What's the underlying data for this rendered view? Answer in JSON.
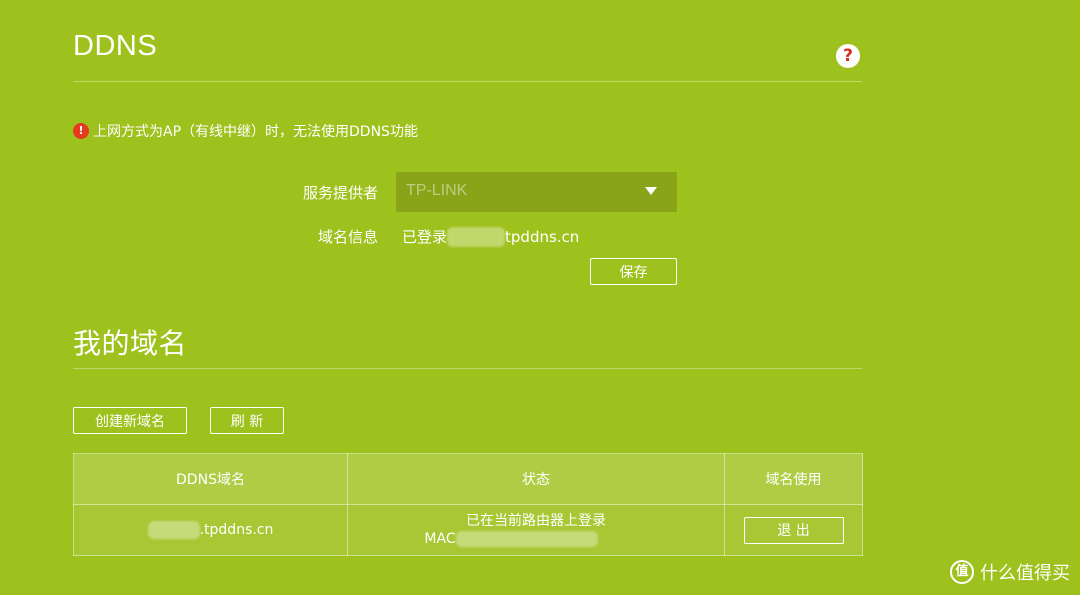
{
  "ddns_section": {
    "title": "DDNS",
    "help_icon": "question-icon",
    "warning_icon": "exclamation-icon",
    "warning_text": "上网方式为AP（有线中继）时，无法使用DDNS功能",
    "provider_label": "服务提供者",
    "provider_value": "TP-LINK",
    "domain_info_label": "域名信息",
    "domain_info_prefix": "已登录",
    "domain_info_suffix": "tpddns.cn",
    "save_button": "保存"
  },
  "my_domains": {
    "title": "我的域名",
    "create_button": "创建新域名",
    "refresh_button": "刷 新",
    "table": {
      "headers": [
        "DDNS域名",
        "状态",
        "域名使用"
      ],
      "rows": [
        {
          "domain_suffix": ".tpddns.cn",
          "status_line1": "已在当前路由器上登录",
          "status_line2_prefix": "MAC",
          "action_button": "退 出"
        }
      ]
    }
  },
  "watermark": {
    "icon": "zhi-icon",
    "icon_glyph": "值",
    "text": "什么值得买"
  },
  "colors": {
    "background": "#9dc21d",
    "warning": "#e53a1e",
    "help_icon_mark": "#d92b1c"
  }
}
